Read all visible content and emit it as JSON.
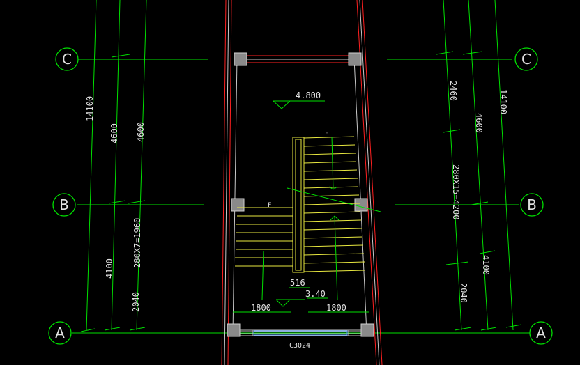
{
  "drawing": {
    "background": "#000000",
    "colors": {
      "axis": "#00e000",
      "wall": "#ff2020",
      "stair": "#e8e840",
      "column": "#a0a0a0",
      "window": "#c0c0c0",
      "text": "#e0e0e0"
    },
    "axes": {
      "A": "A",
      "B": "B",
      "C": "C"
    },
    "dims": {
      "left_total": "14100",
      "left_upper": "4600",
      "left_upper2": "4600",
      "left_lower": "4100",
      "left_bottom": "2040",
      "left_stair": "280X7=1960",
      "right_total": "14100",
      "right_top": "2460",
      "right_mid": "4600",
      "right_lower": "4100",
      "right_bottom": "2040",
      "right_stair": "280X15=4200",
      "bottom_left": "1800",
      "bottom_right": "1800",
      "gap": "516"
    },
    "levels": {
      "upper": "4.800",
      "lower": "3.40"
    },
    "window_label": "C3024",
    "stair_mark": "F"
  }
}
